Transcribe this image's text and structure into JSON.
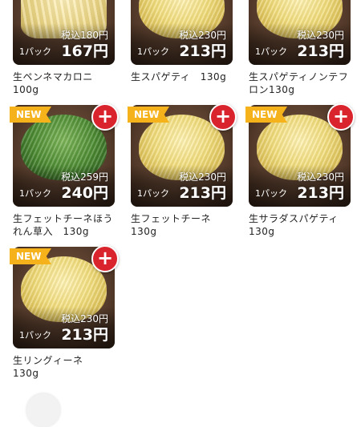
{
  "products": [
    {
      "name_lines": [
        "生ペンネマカロニ",
        "100g"
      ],
      "tax_price": "税込180円",
      "unit": "1パック",
      "price": "167円",
      "is_new": false,
      "pasta": "penne"
    },
    {
      "name_lines": [
        "生スパゲティ　130g",
        ""
      ],
      "tax_price": "税込230円",
      "unit": "1パック",
      "price": "213円",
      "is_new": false,
      "pasta": "yellow"
    },
    {
      "name_lines": [
        "生スパゲティノンテフ",
        "ロン130g"
      ],
      "tax_price": "税込230円",
      "unit": "1パック",
      "price": "213円",
      "is_new": false,
      "pasta": "yellow"
    },
    {
      "name_lines": [
        "生フェットチーネほう",
        "れん草入　130g"
      ],
      "tax_price": "税込259円",
      "unit": "1パック",
      "price": "240円",
      "is_new": true,
      "pasta": "green"
    },
    {
      "name_lines": [
        "生フェットチーネ",
        "130g"
      ],
      "tax_price": "税込230円",
      "unit": "1パック",
      "price": "213円",
      "is_new": true,
      "pasta": "yellow"
    },
    {
      "name_lines": [
        "生サラダスパゲティ",
        "130g"
      ],
      "tax_price": "税込230円",
      "unit": "1パック",
      "price": "213円",
      "is_new": true,
      "pasta": "yellow"
    },
    {
      "name_lines": [
        "生リングィーネ",
        "130g"
      ],
      "tax_price": "税込230円",
      "unit": "1パック",
      "price": "213円",
      "is_new": true,
      "pasta": "yellow"
    }
  ],
  "badge_label": "NEW",
  "add_label": "+",
  "colors": {
    "badge": "#f6b21b",
    "add_button": "#d9232d"
  }
}
